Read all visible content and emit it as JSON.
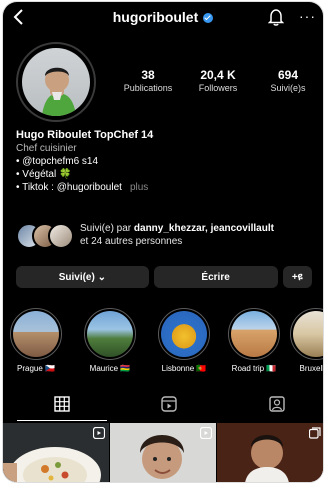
{
  "header": {
    "username": "hugoriboulet",
    "back_icon": "chevron-left-icon",
    "bell_icon": "bell-icon",
    "more_label": "···"
  },
  "stats": [
    {
      "value": "38",
      "label": "Publications"
    },
    {
      "value": "20,4 K",
      "label": "Followers"
    },
    {
      "value": "694",
      "label": "Suivi(e)s"
    }
  ],
  "bio": {
    "name": "Hugo Riboulet TopChef 14",
    "category": "Chef cuisinier",
    "lines": [
      "• @topchefm6 s14",
      "• Végétal 🍀",
      "• Tiktok : @hugoriboulet"
    ],
    "more": "plus"
  },
  "followed_by": {
    "prefix": "Suivi(e) par ",
    "names": "danny_khezzar, jeancovillault",
    "suffix": "et 24 autres personnes"
  },
  "buttons": {
    "follow": "Suivi(e) ⌄",
    "message": "Écrire",
    "add": "+ዩ"
  },
  "highlights": [
    {
      "label": "Prague 🇨🇿"
    },
    {
      "label": "Maurice 🇲🇺"
    },
    {
      "label": "Lisbonne 🇵🇹"
    },
    {
      "label": "Road trip 🇮🇹"
    },
    {
      "label": "Bruxelles"
    }
  ],
  "tabs": [
    "grid-icon",
    "reels-icon",
    "tagged-icon"
  ],
  "colors": {
    "background": "#000000",
    "button": "#262626",
    "verified": "#3897f0"
  }
}
